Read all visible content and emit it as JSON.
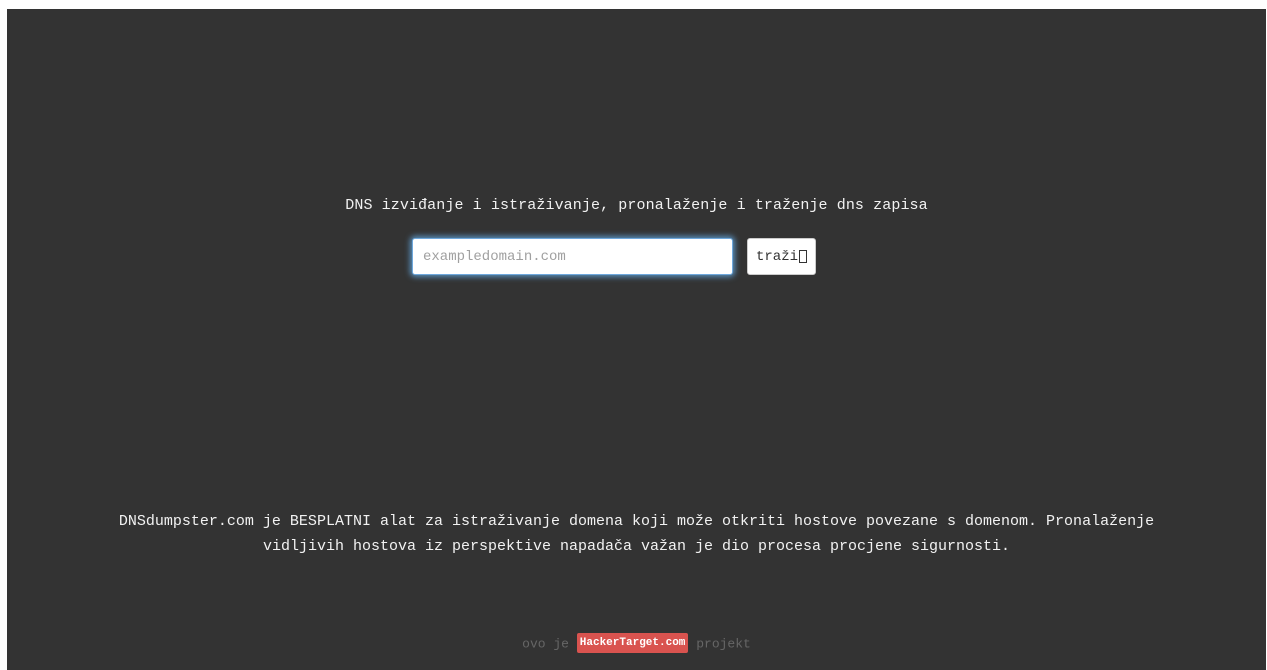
{
  "tagline": "DNS izviđanje i istraživanje, pronalaženje i traženje dns zapisa",
  "search": {
    "placeholder": "exampledomain.com",
    "value": "",
    "button_label": "traži",
    "button_icon": "missing-glyph-box-icon"
  },
  "description": {
    "line1": "DNSdumpster.com je BESPLATNI alat za istraživanje domena koji može otkriti hostove povezane s domenom. Pronalaženje",
    "line2": "vidljivih hostova iz perspektive napadača važan je dio procesa procjene sigurnosti."
  },
  "footer": {
    "prefix": "ovo je",
    "brand": "HackerTarget.com",
    "suffix": "projekt"
  },
  "colors": {
    "background": "#333333",
    "text": "#f2f2f2",
    "footer_text": "#666666",
    "brand_badge": "#d9534f",
    "input_focus_glow": "#66afe9"
  }
}
